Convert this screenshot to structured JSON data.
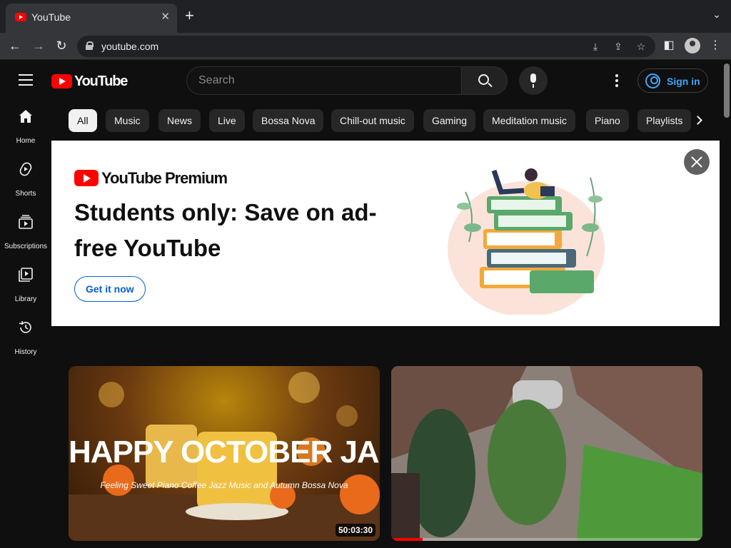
{
  "browser": {
    "tab_title": "YouTube",
    "url": "youtube.com"
  },
  "header": {
    "logo_text": "YouTube",
    "search_placeholder": "Search",
    "sign_in_label": "Sign in"
  },
  "guide": [
    {
      "label": "Home",
      "icon": "home-icon"
    },
    {
      "label": "Shorts",
      "icon": "shorts-icon"
    },
    {
      "label": "Subscriptions",
      "icon": "subscriptions-icon"
    },
    {
      "label": "Library",
      "icon": "library-icon"
    },
    {
      "label": "History",
      "icon": "history-icon"
    }
  ],
  "chips": [
    "All",
    "Music",
    "News",
    "Live",
    "Bossa Nova",
    "Chill-out music",
    "Gaming",
    "Meditation music",
    "Piano",
    "Playlists"
  ],
  "active_chip": "All",
  "banner": {
    "logo_text": "YouTube Premium",
    "headline": "Students only: Save on ad-free YouTube",
    "cta_label": "Get it now"
  },
  "videos": [
    {
      "thumb_title": "HAPPY OCTOBER JAZZ",
      "thumb_subtitle": "Feeling Sweet Piano Coffee Jazz Music and Autumn Bossa Nova",
      "duration": "50:03:30"
    },
    {
      "watched_fraction": 0.1
    }
  ],
  "colors": {
    "brand_red": "#ff0000",
    "link_blue": "#3ea6ff",
    "cta_blue": "#065fd4",
    "background": "#0f0f0f"
  }
}
